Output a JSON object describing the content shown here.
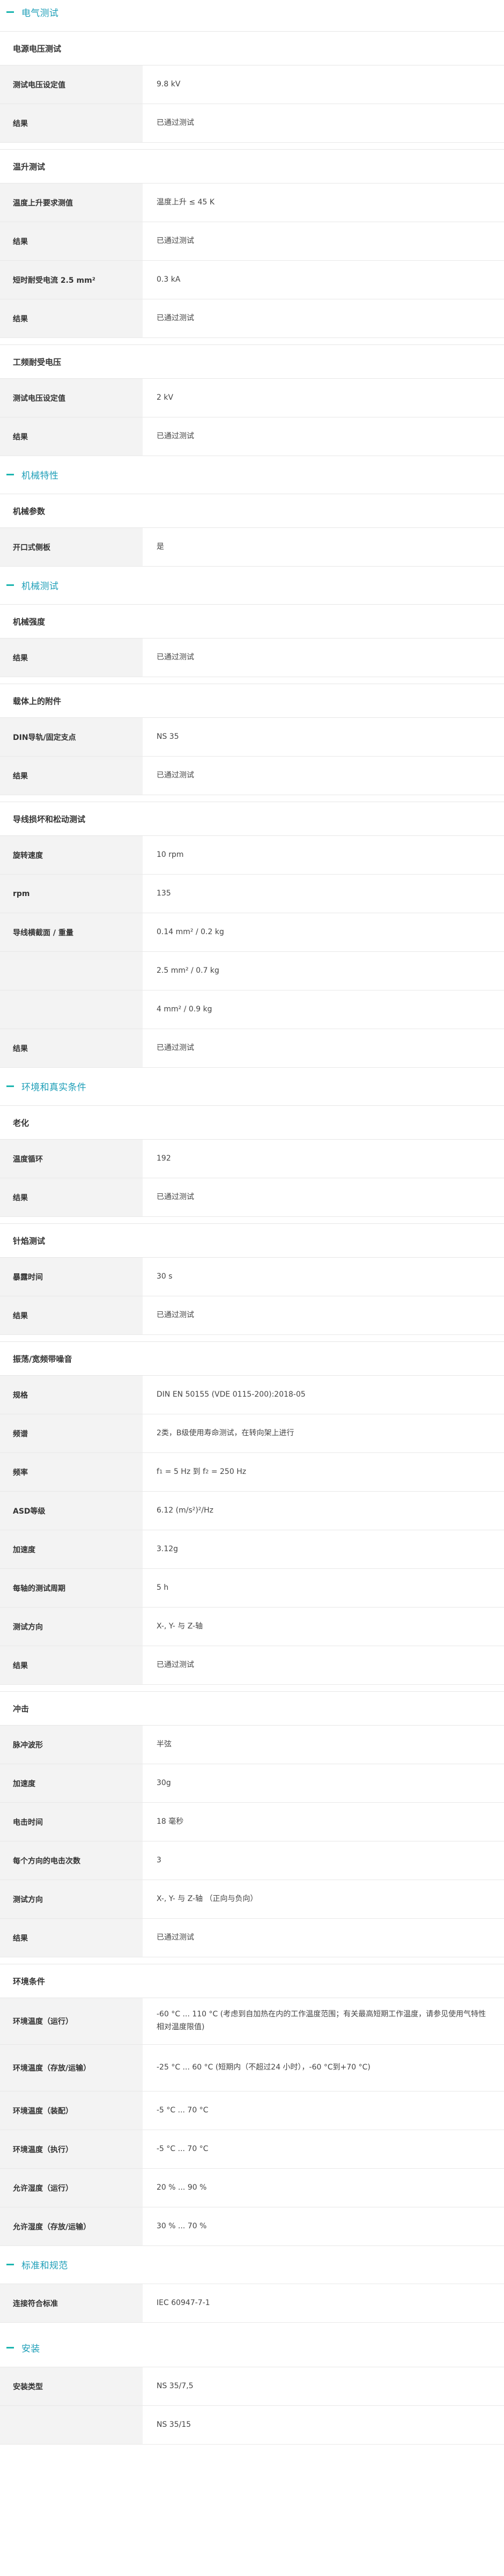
{
  "sections": {
    "electrical": {
      "title": "电气测试",
      "g1": {
        "title": "电源电压测试",
        "r1_label": "测试电压设定值",
        "r1_value": "9.8 kV",
        "r2_label": "结果",
        "r2_value": "已通过测试"
      },
      "g2": {
        "title": "温升测试",
        "r1_label": "温度上升要求测值",
        "r1_value": "温度上升 ≤ 45 K",
        "r2_label": "结果",
        "r2_value": "已通过测试",
        "r3_label": "短时耐受电流 2.5 mm²",
        "r3_value": "0.3 kA",
        "r4_label": "结果",
        "r4_value": "已通过测试"
      },
      "g3": {
        "title": "工频耐受电压",
        "r1_label": "测试电压设定值",
        "r1_value": "2 kV",
        "r2_label": "结果",
        "r2_value": "已通过测试"
      }
    },
    "mechanical_props": {
      "title": "机械特性",
      "g1": {
        "title": "机械参数",
        "r1_label": "开口式侧板",
        "r1_value": "是"
      }
    },
    "mechanical_tests": {
      "title": "机械测试",
      "g1": {
        "title": "机械强度",
        "r1_label": "结果",
        "r1_value": "已通过测试"
      },
      "g2": {
        "title": "载体上的附件",
        "r1_label": "DIN导轨/固定支点",
        "r1_value": "NS 35",
        "r2_label": "结果",
        "r2_value": "已通过测试"
      },
      "g3": {
        "title": "导线损坏和松动测试",
        "r1_label": "旋转速度",
        "r1_value": "10 rpm",
        "r2_label": "rpm",
        "r2_value": "135",
        "r3_label": "导线横截面 / 重量",
        "r3_value": "0.14 mm² / 0.2 kg",
        "r4_value": "2.5 mm² / 0.7 kg",
        "r5_value": "4 mm² / 0.9 kg",
        "r6_label": "结果",
        "r6_value": "已通过测试"
      }
    },
    "environment": {
      "title": "环境和真实条件",
      "g1": {
        "title": "老化",
        "r1_label": "温度循环",
        "r1_value": "192",
        "r2_label": "结果",
        "r2_value": "已通过测试"
      },
      "g2": {
        "title": "针焰测试",
        "r1_label": "暴露时间",
        "r1_value": "30 s",
        "r2_label": "结果",
        "r2_value": "已通过测试"
      },
      "g3": {
        "title": "振荡/宽频带噪音",
        "r1_label": "规格",
        "r1_value": "DIN EN 50155 (VDE 0115-200):2018-05",
        "r2_label": "频谱",
        "r2_value": "2类，B级使用寿命测试，在转向架上进行",
        "r3_label": "频率",
        "r3_value_a": "f",
        "r3_sub_a": "1",
        "r3_value_b": " = 5 Hz 到 f",
        "r3_sub_b": "2",
        "r3_value_c": " = 250 Hz",
        "r4_label": "ASD等级",
        "r4_value": "6.12 (m/s²)²/Hz",
        "r5_label": "加速度",
        "r5_value": "3.12g",
        "r6_label": "每轴的测试周期",
        "r6_value": "5 h",
        "r7_label": "测试方向",
        "r7_value": "X-, Y- 与 Z-轴",
        "r8_label": "结果",
        "r8_value": "已通过测试"
      },
      "g4": {
        "title": "冲击",
        "r1_label": "脉冲波形",
        "r1_value": "半弦",
        "r2_label": "加速度",
        "r2_value": "30g",
        "r3_label": "电击时间",
        "r3_value": "18 毫秒",
        "r4_label": "每个方向的电击次数",
        "r4_value": "3",
        "r5_label": "测试方向",
        "r5_value": "X-, Y- 与 Z-轴 （正向与负向）",
        "r6_label": "结果",
        "r6_value": "已通过测试"
      },
      "g5": {
        "title": "环境条件",
        "r1_label": "环境温度（运行）",
        "r1_value": "-60 °C ... 110 °C (考虑到自加热在内的工作温度范围；有关最高短期工作温度，请参见使用气特性相对温度限值)",
        "r2_label": "环境温度（存放/运输）",
        "r2_value": "-25 °C ... 60 °C (短期内（不超过24 小时），-60 °C到+70 °C)",
        "r3_label": "环境温度（装配）",
        "r3_value": "-5 °C ... 70 °C",
        "r4_label": "环境温度（执行）",
        "r4_value": "-5 °C ... 70 °C",
        "r5_label": "允许湿度（运行）",
        "r5_value": "20 % ... 90 %",
        "r6_label": "允许湿度（存放/运输）",
        "r6_value": "30 % ... 70 %"
      }
    },
    "standards": {
      "title": "标准和规范",
      "r1_label": "连接符合标准",
      "r1_value": "IEC 60947-7-1"
    },
    "installation": {
      "title": "安装",
      "r1_label": "安装类型",
      "r1_value": "NS 35/7,5",
      "r2_value": "NS 35/15"
    }
  },
  "colors": {
    "accent": "#1f9fb8",
    "dash": "#1db5b0",
    "label_bg": "#f3f3f3"
  }
}
